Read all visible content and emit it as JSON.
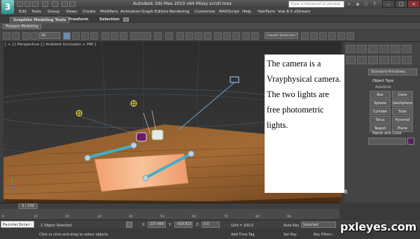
{
  "title_bar": {
    "title": "Autodesk 3ds Max  2010 x64    Missy scroll.max",
    "search_placeholder": "Type a keyword or phrase"
  },
  "menu": [
    "Edit",
    "Tools",
    "Group",
    "Views",
    "Create",
    "Modifiers",
    "Animation",
    "Graph Editors",
    "Rendering",
    "Customize",
    "MAXScript",
    "Help",
    "HairFarm",
    "Vue 8.5 xStream"
  ],
  "ribbon": {
    "tabs": [
      "Graphite Modeling Tools",
      "Freeform",
      "Selection"
    ],
    "panel_label": "Polygon Modeling"
  },
  "toolbar": {
    "filter": "All",
    "selection_set": "Create Selection Se"
  },
  "viewport": {
    "label": "[ + ] [ Perspective ] [ Ambient Occlusion + HW ]"
  },
  "overlay": {
    "text": "The camera is a Vrayphysical camera. The two lights are free photometric lights."
  },
  "command_panel": {
    "dropdown": "Standard Primitives",
    "object_type_title": "Object Type",
    "autogrid": "AutoGrid",
    "buttons": [
      "Box",
      "Cone",
      "Sphere",
      "GeoSphere",
      "Cylinder",
      "Tube",
      "Torus",
      "Pyramid",
      "Teapot",
      "Plane"
    ],
    "name_color_title": "Name and Color",
    "swatch_color": "#5a1d5e"
  },
  "timeline": {
    "frame": "0 / 100",
    "ticks": [
      "0",
      "10",
      "20",
      "30",
      "40",
      "50",
      "60",
      "70",
      "80",
      "90"
    ]
  },
  "status": {
    "maxscript": "PainterInter:",
    "selection": "1 Object Selected",
    "hint": "Click or click-and-drag to select objects",
    "x_label": "X:",
    "x_value": "237.469",
    "y_label": "Y:",
    "y_value": "-918.823",
    "z_label": "Z:",
    "z_value": "0.0",
    "grid": "Grid = 100.0",
    "add_time_tag": "Add Time Tag",
    "auto_key": "Auto Key",
    "set_key": "Set Key",
    "selected": "Selected",
    "key_filters": "Key Filters..."
  },
  "watermark": "pxleyes.com"
}
